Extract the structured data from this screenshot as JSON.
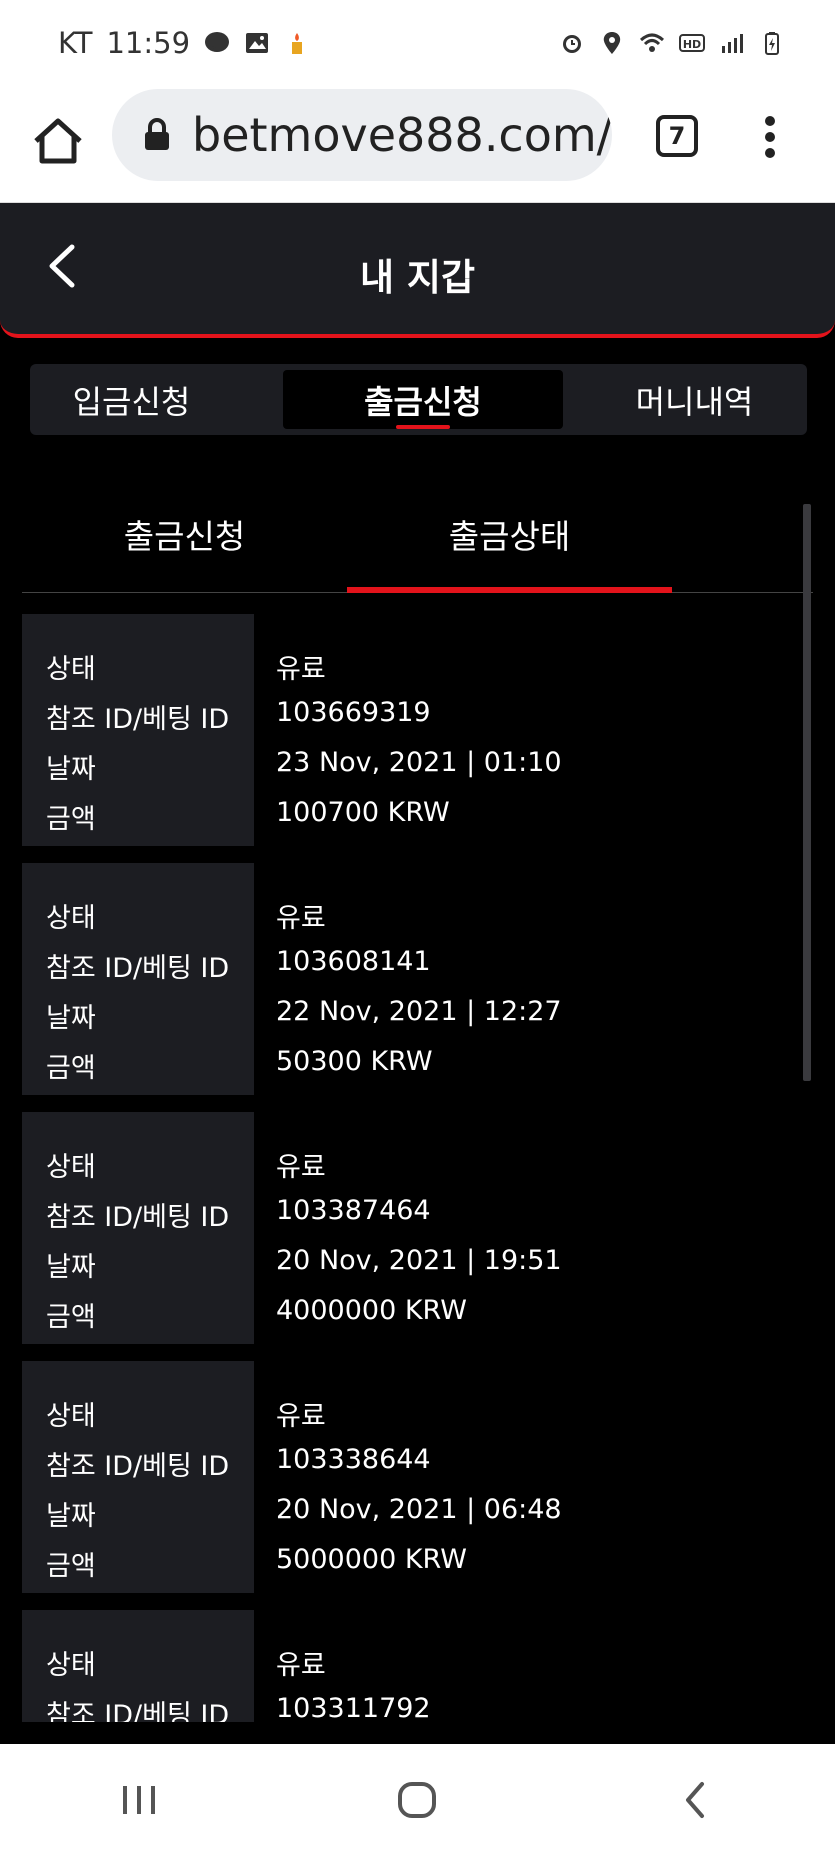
{
  "status_bar": {
    "carrier": "KT",
    "time": "11:59"
  },
  "browser": {
    "url": "betmove888.com/l",
    "tab_count": "7"
  },
  "header": {
    "title": "내 지갑"
  },
  "top_tabs": [
    {
      "label": "입금신청",
      "active": false
    },
    {
      "label": "출금신청",
      "active": true
    },
    {
      "label": "머니내역",
      "active": false
    }
  ],
  "sub_tabs": [
    {
      "label": "출금신청",
      "active": false
    },
    {
      "label": "출금상태",
      "active": true
    }
  ],
  "field_labels": {
    "status": "상태",
    "ref_id": "참조 ID/베팅 ID",
    "date": "날짜",
    "amount": "금액"
  },
  "records": [
    {
      "status": "유료",
      "ref_id": "103669319",
      "date": "23 Nov, 2021 | 01:10",
      "amount": "100700 KRW"
    },
    {
      "status": "유료",
      "ref_id": "103608141",
      "date": "22 Nov, 2021 | 12:27",
      "amount": "50300 KRW"
    },
    {
      "status": "유료",
      "ref_id": "103387464",
      "date": "20 Nov, 2021 | 19:51",
      "amount": "4000000 KRW"
    },
    {
      "status": "유료",
      "ref_id": "103338644",
      "date": "20 Nov, 2021 | 06:48",
      "amount": "5000000 KRW"
    },
    {
      "status": "유료",
      "ref_id": "103311792",
      "date": "",
      "amount": ""
    }
  ],
  "colors": {
    "accent": "#e3131b",
    "panel": "#1c1d22",
    "background": "#000000"
  }
}
